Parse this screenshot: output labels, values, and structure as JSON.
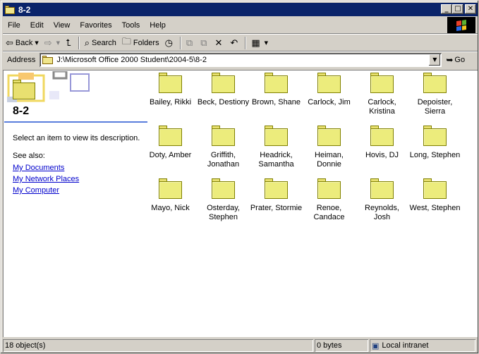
{
  "window": {
    "title": "8-2"
  },
  "menubar": [
    "File",
    "Edit",
    "View",
    "Favorites",
    "Tools",
    "Help"
  ],
  "toolbar": {
    "back": "Back",
    "search": "Search",
    "folders": "Folders"
  },
  "address": {
    "label": "Address",
    "value": "J:\\Microsoft Office 2000 Student\\2004-5\\8-2",
    "go": "Go"
  },
  "webview": {
    "title": "8-2",
    "description": "Select an item to view its description.",
    "see_also": "See also:",
    "links": [
      "My Documents",
      "My Network Places",
      "My Computer"
    ]
  },
  "folders": [
    "Bailey, Rikki",
    "Beck, Destiony",
    "Brown, Shane",
    "Carlock, Jim",
    "Carlock, Kristina",
    "Depoister, Sierra",
    "Doty, Amber",
    "Griffith, Jonathan",
    "Headrick, Samantha",
    "Heiman, Donnie",
    "Hovis, DJ",
    "Long, Stephen",
    "Mayo, Nick",
    "Osterday, Stephen",
    "Prater, Stormie",
    "Renoe, Candace",
    "Reynolds, Josh",
    "West, Stephen"
  ],
  "status": {
    "objects": "18 object(s)",
    "size": "0 bytes",
    "zone": "Local intranet"
  },
  "icons": {
    "back": "back-arrow-icon",
    "forward": "forward-arrow-icon",
    "up": "up-folder-icon",
    "search": "search-icon",
    "folders": "folders-icon",
    "history": "history-icon",
    "move": "move-to-icon",
    "copy": "copy-to-icon",
    "delete": "delete-icon",
    "undo": "undo-icon",
    "views": "views-icon",
    "go": "go-arrow-icon",
    "zone": "intranet-icon"
  }
}
